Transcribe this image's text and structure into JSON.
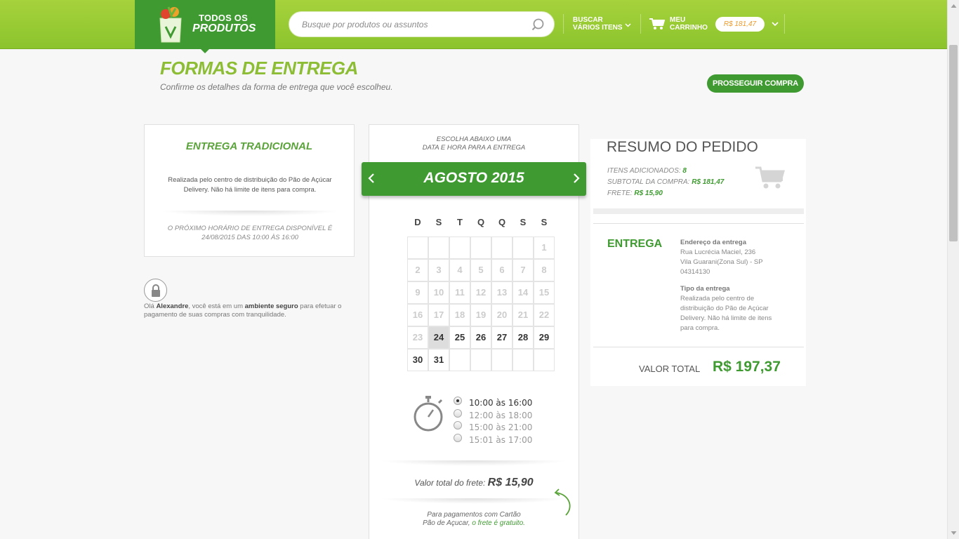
{
  "header": {
    "brand_line1": "TODOS OS",
    "brand_line2": "PRODUTOS",
    "search_placeholder": "Busque por produtos ou assuntos",
    "search_multi_line1": "BUSCAR",
    "search_multi_line2": "VÁRIOS ITENS",
    "cart_line1": "MEU",
    "cart_line2": "CARRINHO",
    "cart_total": "R$ 181,47"
  },
  "page": {
    "title": "FORMAS DE ENTREGA",
    "subtitle": "Confirme os detalhes da forma de entrega que você escolheu.",
    "proceed_label": "PROSSEGUIR COMPRA"
  },
  "delivery_option": {
    "title": "ENTREGA TRADICIONAL",
    "description": "Realizada pelo centro de distribuição do Pão de Açúcar Delivery. Não há limite de itens para compra.",
    "next_slot": "O PRÓXIMO HORÁRIO DE ENTREGA DISPONÍVEL É 24/08/2015 DAS 10:00 ÀS 16:00"
  },
  "secure": {
    "prefix": "Olá ",
    "user": "Alexandre",
    "middle": ", você está em um ",
    "highlight": "ambiente seguro",
    "suffix": " para efetuar o pagamento de suas compras com tranquilidade."
  },
  "calendar": {
    "instruction_line1": "ESCOLHA ABAIXO UMA",
    "instruction_line2": "DATA E HORA PARA A ENTREGA",
    "month": "AGOSTO 2015",
    "weekdays": [
      "D",
      "S",
      "T",
      "Q",
      "Q",
      "S",
      "S"
    ],
    "weeks": [
      [
        "",
        "",
        "",
        "",
        "",
        "",
        "1"
      ],
      [
        "2",
        "3",
        "4",
        "5",
        "6",
        "7",
        "8"
      ],
      [
        "9",
        "10",
        "11",
        "12",
        "13",
        "14",
        "15"
      ],
      [
        "16",
        "17",
        "18",
        "19",
        "20",
        "21",
        "22"
      ],
      [
        "23",
        "24",
        "25",
        "26",
        "27",
        "28",
        "29"
      ],
      [
        "30",
        "31",
        "",
        "",
        "",
        "",
        ""
      ]
    ],
    "first_available_day": 24,
    "selected_day": 24
  },
  "time_slots": [
    {
      "label": "10:00 às 16:00",
      "selected": true
    },
    {
      "label": "12:00 às 18:00",
      "selected": false
    },
    {
      "label": "15:00 às 21:00",
      "selected": false
    },
    {
      "label": "15:01 às 17:00",
      "selected": false
    }
  ],
  "freight": {
    "label": "Valor total do frete: ",
    "value": "R$ 15,90",
    "promo_line1": "Para pagamentos com Cartão",
    "promo_line2_prefix": "Pão de Açucar, ",
    "promo_line2_highlight": "o frete é gratuito."
  },
  "summary": {
    "title": "RESUMO DO PEDIDO",
    "items_label": "ITENS ADICIONADOS: ",
    "items_value": "8",
    "subtotal_label": "SUBTOTAL DA COMPRA: ",
    "subtotal_value": "R$ 181,47",
    "freight_label": "FRETE: ",
    "freight_value": "R$ 15,90",
    "delivery_title": "ENTREGA",
    "address_title": "Endereço da entrega",
    "address_line1": "Rua Lucrécia Maciel, 236",
    "address_line2": "Vila Guarani(Zona Sul) - SP",
    "address_line3": "04314130",
    "type_title": "Tipo da entrega",
    "type_line1": "Realizada pelo centro de",
    "type_line2": "distribuição do Pão de Açúcar",
    "type_line3": "Delivery. Não há limite de itens",
    "type_line4": "para compra.",
    "total_label": "VALOR TOTAL",
    "total_value": "R$ 197,37"
  },
  "colors": {
    "header_green": "#8cc42d",
    "brand_green": "#3f9b31",
    "title_green": "#8cbd34",
    "cart_price_orange": "#f09a2b"
  },
  "icons": [
    "shopping-bag-icon",
    "search-icon",
    "chevron-down-icon",
    "cart-icon",
    "lock-icon",
    "chevron-left-icon",
    "chevron-right-icon",
    "stopwatch-icon",
    "curved-arrow-icon"
  ]
}
